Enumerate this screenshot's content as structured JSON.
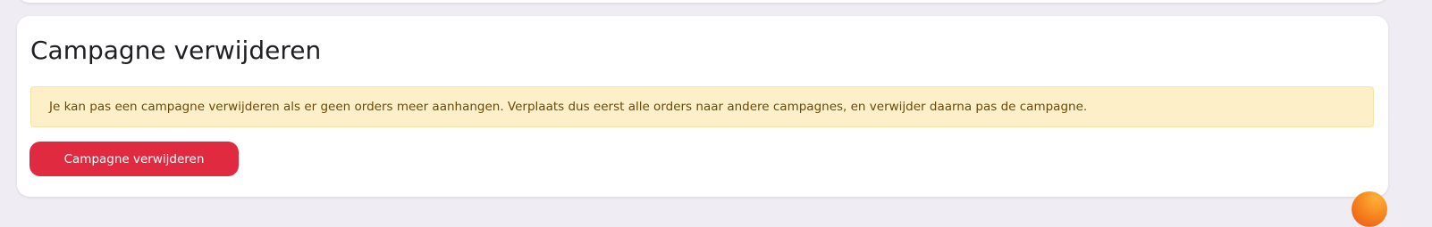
{
  "section": {
    "title": "Campagne verwijderen",
    "warning": "Je kan pas een campagne verwijderen als er geen orders meer aanhangen. Verplaats dus eerst alle orders naar andere campagnes, en verwijder daarna pas de campagne.",
    "delete_button_label": "Campagne verwijderen"
  },
  "colors": {
    "page_background": "#efedf3",
    "card_background": "#ffffff",
    "warning_background": "#fdf0c8",
    "warning_text": "#6b4a07",
    "danger_button": "#e02a40",
    "fab_accent": "#f7871f"
  },
  "icons": {
    "floating_button": "orange-circle-icon"
  }
}
